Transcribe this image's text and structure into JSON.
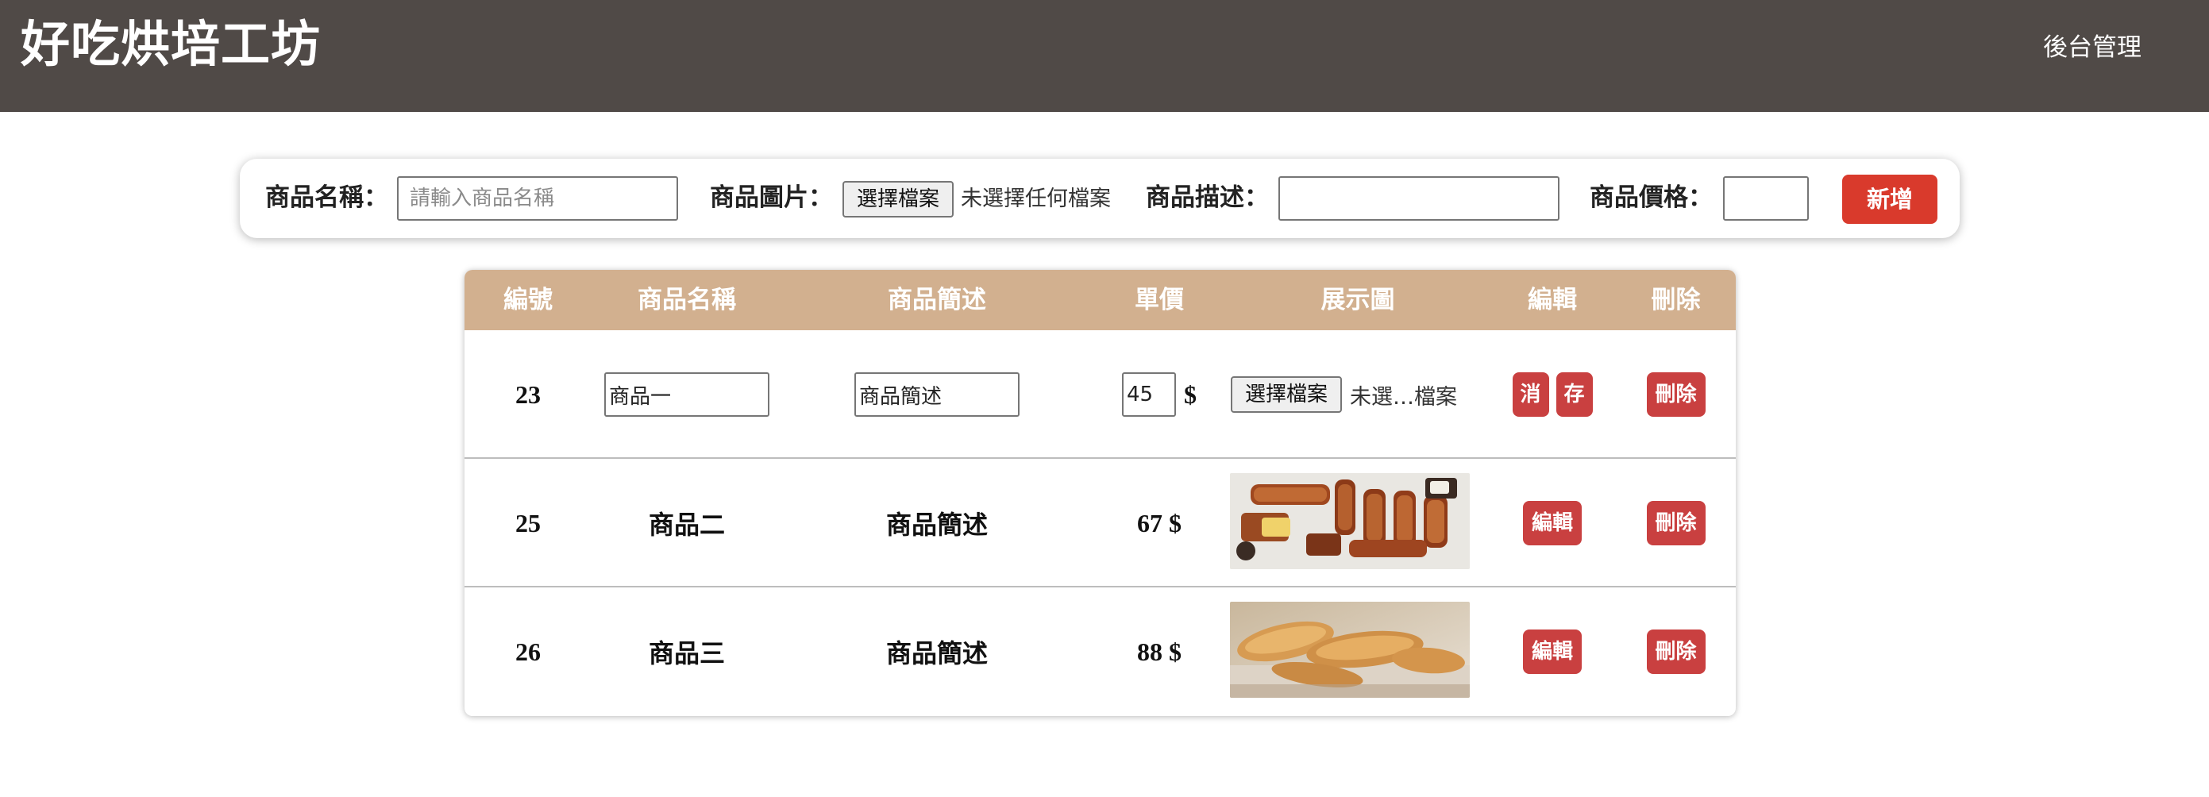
{
  "header": {
    "brand": "好吃烘培工坊",
    "admin_link": "後台管理"
  },
  "form": {
    "name_label": "商品名稱：",
    "name_placeholder": "請輸入商品名稱",
    "image_label": "商品圖片：",
    "file_button": "選擇檔案",
    "file_status": "未選擇任何檔案",
    "desc_label": "商品描述：",
    "price_label": "商品價格：",
    "add_button": "新增"
  },
  "table": {
    "headers": [
      "編號",
      "商品名稱",
      "商品簡述",
      "單價",
      "展示圖",
      "編輯",
      "刪除"
    ],
    "editing_row": {
      "id": "23",
      "name_value": "商品一",
      "desc_value": "商品簡述",
      "price_value": "45",
      "currency": "$",
      "file_button": "選擇檔案",
      "file_status": "未選…檔案",
      "cancel_label": "消",
      "save_label": "存",
      "delete_label": "刪除"
    },
    "rows": [
      {
        "id": "25",
        "name": "商品二",
        "desc": "商品簡述",
        "price": "67 $",
        "image": "pastry-twists-photo",
        "edit_label": "編輯",
        "delete_label": "刪除"
      },
      {
        "id": "26",
        "name": "商品三",
        "desc": "商品簡述",
        "price": "88 $",
        "image": "croissants-photo",
        "edit_label": "編輯",
        "delete_label": "刪除"
      }
    ]
  },
  "colors": {
    "header_bg": "#504a47",
    "table_header_bg": "#d2b08f",
    "add_button": "#d93a2c",
    "action_button": "#c94040"
  }
}
